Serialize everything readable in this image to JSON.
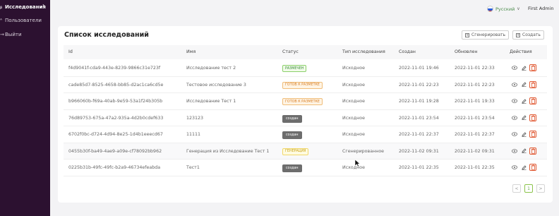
{
  "sidebar": {
    "items": [
      {
        "label": "Исследования",
        "icon": "flask-icon",
        "active": true
      },
      {
        "label": "Пользователи",
        "icon": "user-icon",
        "active": false
      },
      {
        "label": "Выйти",
        "icon": "logout-icon",
        "active": false
      }
    ]
  },
  "topbar": {
    "language": "Русский",
    "user": "First Admin"
  },
  "card": {
    "title": "Список исследований",
    "generate_label": "Сгенерировать",
    "create_label": "Создать"
  },
  "table": {
    "columns": [
      "Id",
      "Имя",
      "Статус",
      "Тип исследования",
      "Создан",
      "Обновлен",
      "Действия"
    ],
    "rows": [
      {
        "id": "f4d9041f-cda9-443e-8239-9866c31e723f",
        "name": "Исследование тест 2",
        "status": "РАЗМЕЧЕН",
        "status_kind": "green",
        "type": "Исходное",
        "created": "2022-11-01 19:46",
        "updated": "2022-11-01 22:33"
      },
      {
        "id": "cade85d7-8525-4658-bb85-d2ac1ca6cd5e",
        "name": "Тестовое исследование 3",
        "status": "ГОТОВ К РАЗМЕТКЕ",
        "status_kind": "orange",
        "type": "Исходное",
        "created": "2022-11-01 22:23",
        "updated": "2022-11-01 22:23"
      },
      {
        "id": "b966060b-f69a-40ab-9e59-53a1f24b305b",
        "name": "Исследование Тест 1",
        "status": "ГОТОВ К РАЗМЕТКЕ",
        "status_kind": "orange",
        "type": "Исходное",
        "created": "2022-11-01 19:28",
        "updated": "2022-11-01 19:33"
      },
      {
        "id": "76d89753-675a-47a2-935a-4d2b0cdef633",
        "name": "123123",
        "status": "создан",
        "status_kind": "dark",
        "type": "Исходное",
        "created": "2022-11-01 23:54",
        "updated": "2022-11-01 23:54"
      },
      {
        "id": "6702f0bc-d724-4d94-8e25-1d4b1eeecd67",
        "name": "11111",
        "status": "создан",
        "status_kind": "dark",
        "type": "Исходное",
        "created": "2022-11-01 22:37",
        "updated": "2022-11-01 22:37"
      },
      {
        "id": "0455b30f-ba49-4ae9-a09e-cf78092bb962",
        "name": "Генерация из Исследование Тест 1",
        "status": "ГЕНЕРАЦИЯ",
        "status_kind": "yellow",
        "type": "Сгенерированное",
        "created": "2022-11-02 09:31",
        "updated": "2022-11-02 09:31"
      },
      {
        "id": "0225b31b-49fc-49fc-b2a9-46734efeabda",
        "name": "Тест1",
        "status": "создан",
        "status_kind": "dark",
        "type": "Исходное",
        "created": "2022-11-01 22:35",
        "updated": "2022-11-01 22:35"
      }
    ]
  },
  "pagination": {
    "prev": "<",
    "current": "1",
    "next": ">"
  },
  "colors": {
    "sidebar_bg": "#2c1130",
    "accent": "#8bc34a",
    "danger": "#e0562f"
  }
}
